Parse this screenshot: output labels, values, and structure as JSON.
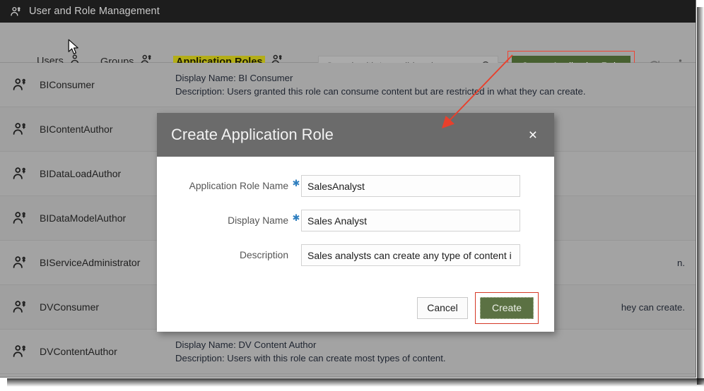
{
  "window": {
    "title": "User and Role Management",
    "title_icon": "users-icon"
  },
  "toolbar": {
    "tabs": [
      {
        "label": "Users",
        "icon": "user-icon",
        "active": false
      },
      {
        "label": "Groups",
        "icon": "users-icon",
        "active": false
      },
      {
        "label": "Application Roles",
        "icon": "users-icon",
        "active": true
      }
    ],
    "search": {
      "placeholder": "Search with * as wildcard",
      "value": "",
      "icon": "search-icon"
    },
    "create_button": "Create Application Role",
    "refresh_icon": "refresh-icon",
    "overflow_icon": "more-vertical-icon"
  },
  "list": {
    "rows": [
      {
        "name": "BIConsumer",
        "display_name": "Display Name: BI Consumer",
        "description": "Description: Users granted this role can consume content but are restricted in what they can create."
      },
      {
        "name": "BIContentAuthor",
        "display_name": "",
        "description": ""
      },
      {
        "name": "BIDataLoadAuthor",
        "display_name": "",
        "description": ""
      },
      {
        "name": "BIDataModelAuthor",
        "display_name": "",
        "description": ""
      },
      {
        "name": "BIServiceAdministrator",
        "display_name": "",
        "description": "n."
      },
      {
        "name": "DVConsumer",
        "display_name": "",
        "description": "hey can create."
      },
      {
        "name": "DVContentAuthor",
        "display_name": "Display Name: DV Content Author",
        "description": "Description: Users with this role can create most types of content."
      }
    ]
  },
  "dialog": {
    "title": "Create Application Role",
    "close_icon": "close-icon",
    "fields": [
      {
        "label": "Application Role Name",
        "required": true,
        "value": "SalesAnalyst",
        "placeholder": ""
      },
      {
        "label": "Display Name",
        "required": true,
        "value": "Sales Analyst",
        "placeholder": ""
      },
      {
        "label": "Description",
        "required": false,
        "value": "Sales analysts can create any type of content i",
        "placeholder": ""
      }
    ],
    "cancel_label": "Cancel",
    "create_label": "Create"
  },
  "colors": {
    "annotation_red": "#e8402c",
    "tab_highlight": "#b3ae17",
    "tab_underline": "#5d7a3e",
    "primary_green": "#476030",
    "titlebar": "#1d1d1d",
    "chrome_gray": "#a3a3a3",
    "dialog_header": "#6b6b6b"
  }
}
